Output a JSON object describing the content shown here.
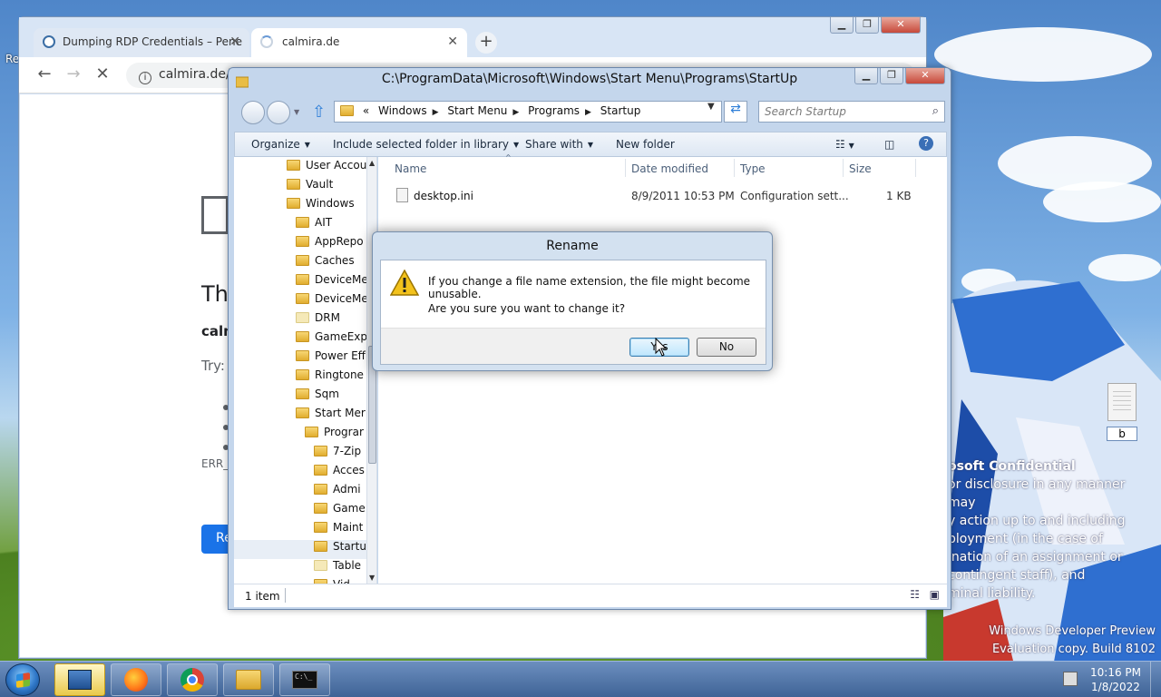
{
  "desktop": {
    "left_label": "Re",
    "watermark_title": "osoft Confidential",
    "watermark_lines": [
      "or disclosure in any manner may",
      "y action up to and including",
      "ployment (in the case of",
      "ination of an assignment or",
      "contingent staff), and",
      "minal liability."
    ],
    "build_line1": "Windows Developer Preview",
    "build_line2": "Evaluation copy. Build 8102",
    "desktop_file_label": "b"
  },
  "browser": {
    "tabs": [
      {
        "label": "Dumping RDP Credentials – Pene",
        "icon": "wordpress-icon"
      },
      {
        "label": "calmira.de",
        "icon": "loading-spinner-icon"
      }
    ],
    "new_tab": "+",
    "address": "calmira.de/do",
    "error": {
      "title": "Th",
      "host": "calm",
      "try": "Try:",
      "code": "ERR_C",
      "reload": "Re"
    }
  },
  "explorer": {
    "title": "C:\\ProgramData\\Microsoft\\Windows\\Start Menu\\Programs\\StartUp",
    "breadcrumbs": [
      "«",
      "Windows",
      "Start Menu",
      "Programs",
      "Startup"
    ],
    "search_placeholder": "Search Startup",
    "commands": [
      "Organize",
      "Include selected folder in library",
      "Share with",
      "New folder"
    ],
    "nav_items": [
      {
        "label": "User Accou",
        "indent": 0
      },
      {
        "label": "Vault",
        "indent": 0
      },
      {
        "label": "Windows",
        "indent": 0
      },
      {
        "label": "AIT",
        "indent": 1
      },
      {
        "label": "AppRepo",
        "indent": 1
      },
      {
        "label": "Caches",
        "indent": 1
      },
      {
        "label": "DeviceMe",
        "indent": 1
      },
      {
        "label": "DeviceMe",
        "indent": 1
      },
      {
        "label": "DRM",
        "indent": 1
      },
      {
        "label": "GameExp",
        "indent": 1
      },
      {
        "label": "Power Eff",
        "indent": 1
      },
      {
        "label": "Ringtone",
        "indent": 1
      },
      {
        "label": "Sqm",
        "indent": 1
      },
      {
        "label": "Start Mer",
        "indent": 1
      },
      {
        "label": "Prograr",
        "indent": 2
      },
      {
        "label": "7-Zip",
        "indent": 3
      },
      {
        "label": "Acces",
        "indent": 3
      },
      {
        "label": "Admi",
        "indent": 3
      },
      {
        "label": "Game",
        "indent": 3
      },
      {
        "label": "Maint",
        "indent": 3
      },
      {
        "label": "Startu",
        "indent": 3
      },
      {
        "label": "Table",
        "indent": 3
      },
      {
        "label": "Vid",
        "indent": 3
      }
    ],
    "columns": [
      "Name",
      "Date modified",
      "Type",
      "Size"
    ],
    "files": [
      {
        "name": "desktop.ini",
        "date": "8/9/2011 10:53 PM",
        "type": "Configuration sett...",
        "size": "1 KB"
      }
    ],
    "status": "1 item"
  },
  "dialog": {
    "title": "Rename",
    "message": "If you change a file name extension, the file might become unusable.",
    "question": "Are you sure you want to change it?",
    "yes": "Yes",
    "no": "No"
  },
  "taskbar": {
    "time": "10:16 PM",
    "date": "1/8/2022",
    "apps": [
      "rdp-icon",
      "firefox-icon",
      "chrome-icon",
      "explorer-icon",
      "cmd-icon"
    ]
  }
}
